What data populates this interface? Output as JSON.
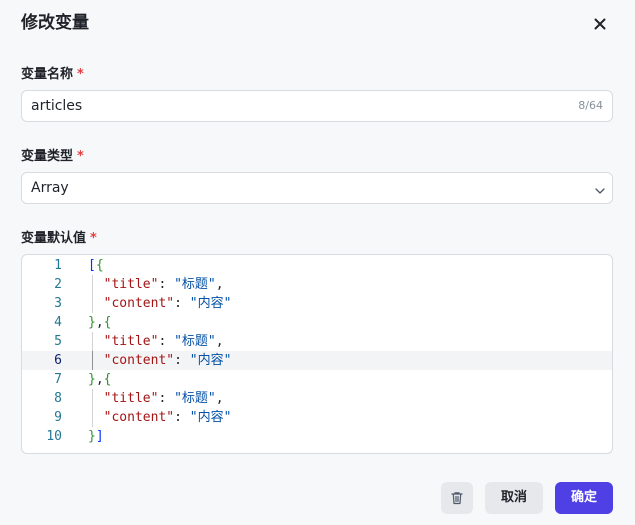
{
  "dialog": {
    "title": "修改变量",
    "close_icon": "close-icon"
  },
  "fields": {
    "name": {
      "label": "变量名称",
      "required_mark": "*",
      "value": "articles",
      "counter": "8/64"
    },
    "type": {
      "label": "变量类型",
      "required_mark": "*",
      "selected": "Array",
      "icon": "chevron-down-icon"
    },
    "default_value": {
      "label": "变量默认值",
      "required_mark": "*",
      "active_line": 6,
      "lines": [
        {
          "num": "1",
          "prefix": "",
          "tokens": [
            {
              "t": "[",
              "c": "bracket1"
            },
            {
              "t": "{",
              "c": "bracket2"
            }
          ]
        },
        {
          "num": "2",
          "prefix": "  ",
          "tokens": [
            {
              "t": "\"title\"",
              "c": "key"
            },
            {
              "t": ": ",
              "c": "punc"
            },
            {
              "t": "\"标题\"",
              "c": "str"
            },
            {
              "t": ",",
              "c": "punc"
            }
          ]
        },
        {
          "num": "3",
          "prefix": "  ",
          "tokens": [
            {
              "t": "\"content\"",
              "c": "key"
            },
            {
              "t": ": ",
              "c": "punc"
            },
            {
              "t": "\"内容\"",
              "c": "str"
            }
          ]
        },
        {
          "num": "4",
          "prefix": "",
          "tokens": [
            {
              "t": "}",
              "c": "bracket2"
            },
            {
              "t": ",",
              "c": "punc"
            },
            {
              "t": "{",
              "c": "bracket2"
            }
          ]
        },
        {
          "num": "5",
          "prefix": "  ",
          "tokens": [
            {
              "t": "\"title\"",
              "c": "key"
            },
            {
              "t": ": ",
              "c": "punc"
            },
            {
              "t": "\"标题\"",
              "c": "str"
            },
            {
              "t": ",",
              "c": "punc"
            }
          ]
        },
        {
          "num": "6",
          "prefix": "  ",
          "tokens": [
            {
              "t": "\"content\"",
              "c": "key"
            },
            {
              "t": ": ",
              "c": "punc"
            },
            {
              "t": "\"内容\"",
              "c": "str"
            }
          ]
        },
        {
          "num": "7",
          "prefix": "",
          "tokens": [
            {
              "t": "}",
              "c": "bracket2"
            },
            {
              "t": ",",
              "c": "punc"
            },
            {
              "t": "{",
              "c": "bracket2"
            }
          ]
        },
        {
          "num": "8",
          "prefix": "  ",
          "tokens": [
            {
              "t": "\"title\"",
              "c": "key"
            },
            {
              "t": ": ",
              "c": "punc"
            },
            {
              "t": "\"标题\"",
              "c": "str"
            },
            {
              "t": ",",
              "c": "punc"
            }
          ]
        },
        {
          "num": "9",
          "prefix": "  ",
          "tokens": [
            {
              "t": "\"content\"",
              "c": "key"
            },
            {
              "t": ": ",
              "c": "punc"
            },
            {
              "t": "\"内容\"",
              "c": "str"
            }
          ]
        },
        {
          "num": "10",
          "prefix": "",
          "tokens": [
            {
              "t": "}",
              "c": "bracket2"
            },
            {
              "t": "]",
              "c": "bracket1"
            }
          ]
        }
      ]
    }
  },
  "footer": {
    "delete_icon": "trash-icon",
    "cancel_label": "取消",
    "confirm_label": "确定"
  },
  "colors": {
    "primary": "#4e40e5",
    "required": "#e53e3e",
    "background": "#f7f8fa"
  }
}
